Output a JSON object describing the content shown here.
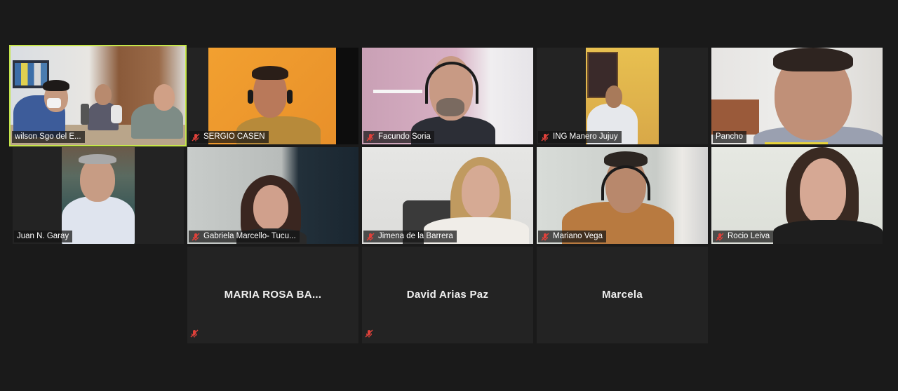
{
  "participants": [
    {
      "name": "wilson Sgo del E...",
      "muted": false,
      "video": true,
      "active": true
    },
    {
      "name": "SERGIO CASEN",
      "muted": true,
      "video": true
    },
    {
      "name": "Facundo Soria",
      "muted": true,
      "video": true
    },
    {
      "name": "ING Manero Jujuy",
      "muted": true,
      "video": true
    },
    {
      "name": "Pancho",
      "muted": false,
      "video": true,
      "speaking": true
    },
    {
      "name": "Juan N. Garay",
      "muted": false,
      "video": true
    },
    {
      "name": "Gabriela Marcello- Tucu...",
      "muted": true,
      "video": true
    },
    {
      "name": "Jimena de la Barrera",
      "muted": true,
      "video": true
    },
    {
      "name": "Mariano Vega",
      "muted": true,
      "video": true
    },
    {
      "name": "Rocio Leiva",
      "muted": true,
      "video": true
    },
    {
      "name": "MARIA  ROSA  BA...",
      "muted": true,
      "video": false
    },
    {
      "name": "David Arias Paz",
      "muted": true,
      "video": false
    },
    {
      "name": "Marcela",
      "muted": false,
      "video": false
    }
  ],
  "colors": {
    "active_border": "#c6e64a",
    "speaking_indicator": "#e8d33a",
    "muted_icon": "#e0413a",
    "background": "#1a1a1a",
    "tile": "#232323"
  }
}
